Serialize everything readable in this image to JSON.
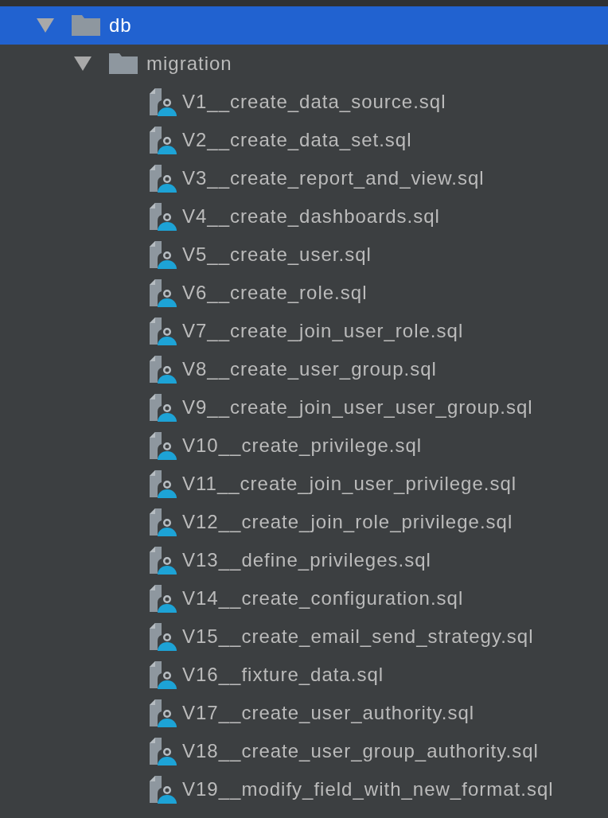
{
  "tree": [
    {
      "kind": "folder",
      "name": "db",
      "expanded": true,
      "selected": true,
      "children": [
        {
          "kind": "folder",
          "name": "migration",
          "expanded": true,
          "selected": false,
          "children": [
            {
              "kind": "sql",
              "name": "V1__create_data_source.sql",
              "selected": false
            },
            {
              "kind": "sql",
              "name": "V2__create_data_set.sql",
              "selected": false
            },
            {
              "kind": "sql",
              "name": "V3__create_report_and_view.sql",
              "selected": false
            },
            {
              "kind": "sql",
              "name": "V4__create_dashboards.sql",
              "selected": false
            },
            {
              "kind": "sql",
              "name": "V5__create_user.sql",
              "selected": false
            },
            {
              "kind": "sql",
              "name": "V6__create_role.sql",
              "selected": false
            },
            {
              "kind": "sql",
              "name": "V7__create_join_user_role.sql",
              "selected": false
            },
            {
              "kind": "sql",
              "name": "V8__create_user_group.sql",
              "selected": false
            },
            {
              "kind": "sql",
              "name": "V9__create_join_user_user_group.sql",
              "selected": false
            },
            {
              "kind": "sql",
              "name": "V10__create_privilege.sql",
              "selected": false
            },
            {
              "kind": "sql",
              "name": "V11__create_join_user_privilege.sql",
              "selected": false
            },
            {
              "kind": "sql",
              "name": "V12__create_join_role_privilege.sql",
              "selected": false
            },
            {
              "kind": "sql",
              "name": "V13__define_privileges.sql",
              "selected": false
            },
            {
              "kind": "sql",
              "name": "V14__create_configuration.sql",
              "selected": false
            },
            {
              "kind": "sql",
              "name": "V15__create_email_send_strategy.sql",
              "selected": false
            },
            {
              "kind": "sql",
              "name": "V16__fixture_data.sql",
              "selected": false
            },
            {
              "kind": "sql",
              "name": "V17__create_user_authority.sql",
              "selected": false
            },
            {
              "kind": "sql",
              "name": "V18__create_user_group_authority.sql",
              "selected": false
            },
            {
              "kind": "sql",
              "name": "V19__modify_field_with_new_format.sql",
              "selected": false
            }
          ]
        }
      ]
    }
  ]
}
